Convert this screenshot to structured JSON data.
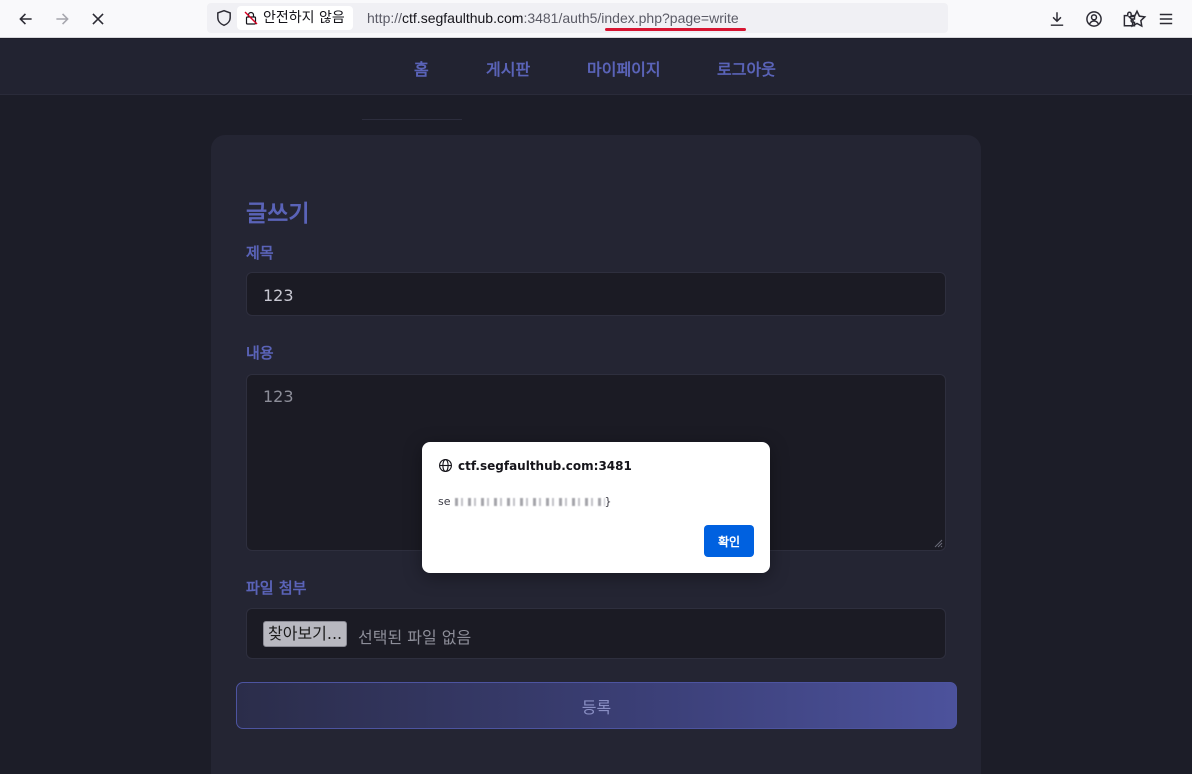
{
  "browser": {
    "security_label": "안전하지 않음",
    "url_scheme": "http://",
    "url_host": "ctf.segfaulthub.com",
    "url_path": ":3481/auth5/index.php?page=write"
  },
  "nav": {
    "items": [
      {
        "label": "홈"
      },
      {
        "label": "게시판"
      },
      {
        "label": "마이페이지"
      },
      {
        "label": "로그아웃"
      }
    ]
  },
  "form": {
    "title": "글쓰기",
    "subject_label": "제목",
    "subject_value": "123",
    "content_label": "내용",
    "content_value": "123",
    "file_label": "파일 첨부",
    "file_button_label": "찾아보기...",
    "file_status": "선택된 파일 없음",
    "submit_label": "등록"
  },
  "dialog": {
    "origin": "ctf.segfaulthub.com:3481",
    "message_prefix": "se",
    "message_suffix": "}",
    "ok_label": "확인"
  },
  "colors": {
    "accent": "#5a63b8",
    "dialog_button": "#0061e0",
    "url_underline": "#d71531"
  }
}
